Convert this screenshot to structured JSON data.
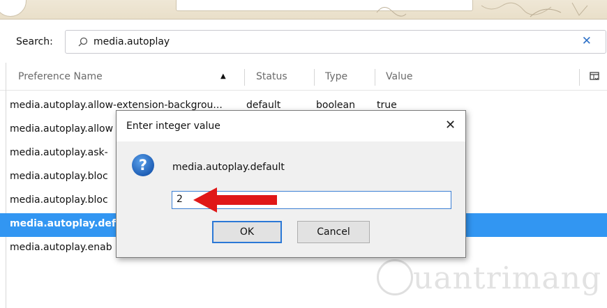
{
  "search": {
    "label": "Search:",
    "value": "media.autoplay",
    "clear_icon": "close-icon"
  },
  "columns": {
    "name": "Preference Name",
    "status": "Status",
    "type": "Type",
    "value": "Value",
    "sort": "ascending",
    "picker_icon": "column-picker-icon"
  },
  "rows": [
    {
      "name": "media.autoplay.allow-extension-backgrou...",
      "status": "default",
      "type": "boolean",
      "value": "true"
    },
    {
      "name": "media.autoplay.allow",
      "status": "",
      "type": "",
      "value": ""
    },
    {
      "name": "media.autoplay.ask-",
      "status": "",
      "type": "",
      "value": ""
    },
    {
      "name": "media.autoplay.bloc",
      "status": "",
      "type": "",
      "value": ""
    },
    {
      "name": "media.autoplay.bloc",
      "status": "",
      "type": "",
      "value": ""
    },
    {
      "name": "media.autoplay.defa",
      "status": "",
      "type": "",
      "value": "",
      "selected": true
    },
    {
      "name": "media.autoplay.enab",
      "status": "",
      "type": "",
      "value": ""
    }
  ],
  "dialog": {
    "title": "Enter integer value",
    "message": "media.autoplay.default",
    "input_value": "2",
    "ok_label": "OK",
    "cancel_label": "Cancel",
    "icon": "question-icon",
    "close_icon": "close-icon"
  },
  "watermark": {
    "text": "uantrimang"
  },
  "colors": {
    "selection": "#3296f2",
    "accent": "#2f72c8",
    "arrow": "#e01818"
  }
}
